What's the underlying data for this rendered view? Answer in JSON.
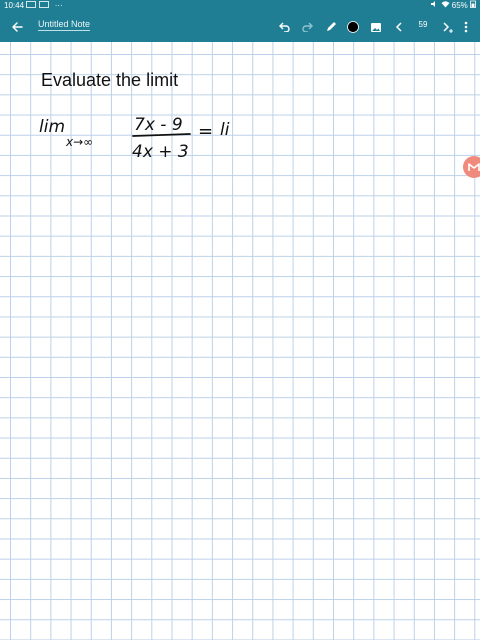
{
  "status": {
    "time": "10:44",
    "battery": "65%"
  },
  "toolbar": {
    "title": "Untitled Note",
    "page": "59"
  },
  "note": {
    "heading": "Evaluate the limit",
    "lim_head": "lim",
    "lim_sub": "x→∞",
    "numerator": "7x - 9",
    "denominator": "4x + 3",
    "equals": "=",
    "continued": "li"
  },
  "icons": {
    "back": "arrow-left-icon",
    "undo": "undo-icon",
    "redo": "redo-icon",
    "pen": "pen-icon",
    "color": "color-dot-icon",
    "insert": "image-icon",
    "prev": "chevron-left-icon",
    "next": "chevron-right-plus-icon",
    "more": "more-vertical-icon",
    "side_tab": "m-badge-icon"
  },
  "colors": {
    "toolbar": "#1f7e93",
    "grid": "#bcd1e8",
    "ink": "#111111",
    "side_tab": "#f08a7c"
  }
}
